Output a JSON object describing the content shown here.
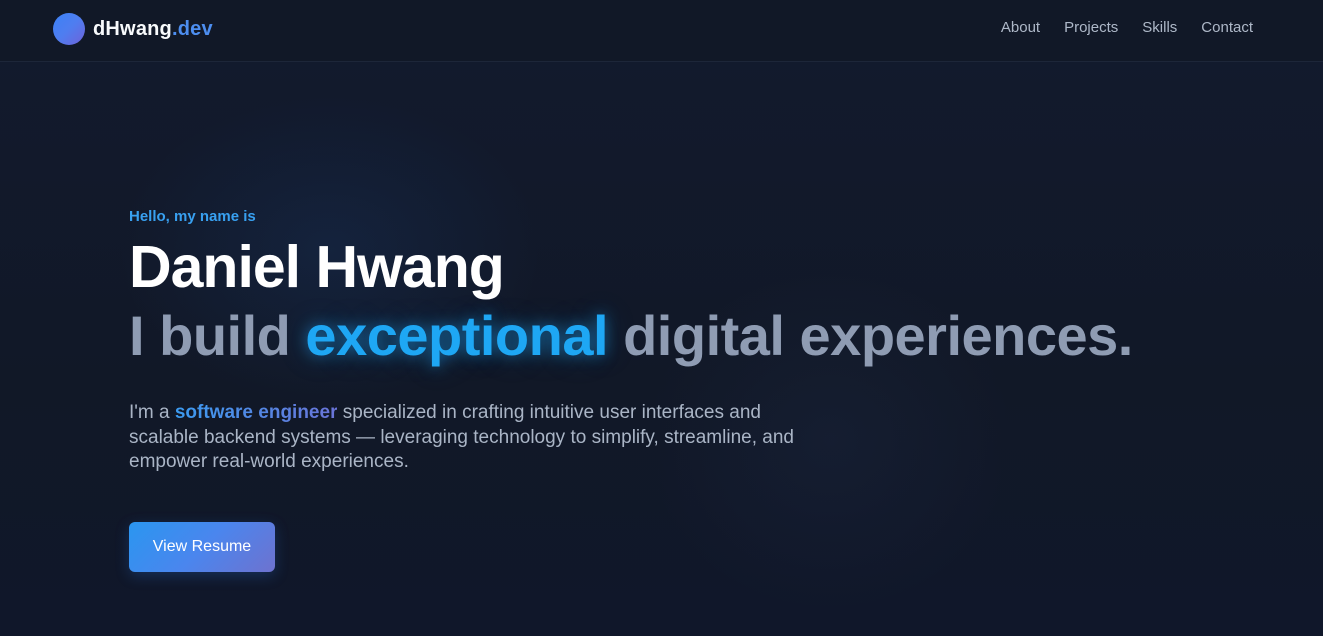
{
  "nav": {
    "brand_main": "dHwang",
    "brand_accent": ".dev",
    "links": [
      {
        "label": "About"
      },
      {
        "label": "Projects"
      },
      {
        "label": "Skills"
      },
      {
        "label": "Contact"
      }
    ]
  },
  "hero": {
    "greeting": "Hello, my name is",
    "name": "Daniel Hwang",
    "tagline_pre": "I build ",
    "tagline_highlight": "exceptional",
    "tagline_post": " digital experiences.",
    "intro_pre": "I'm a ",
    "intro_highlight": "software engineer",
    "intro_post": " specialized in crafting intuitive user interfaces and scalable backend systems — leveraging technology to simplify, streamline, and empower real-world experiences.",
    "button_label": "View Resume"
  },
  "colors": {
    "background": "#121a2e",
    "accent": "#1ea7f4",
    "brand_accent": "#4d8ef0",
    "muted_text": "#8f9cb3"
  }
}
